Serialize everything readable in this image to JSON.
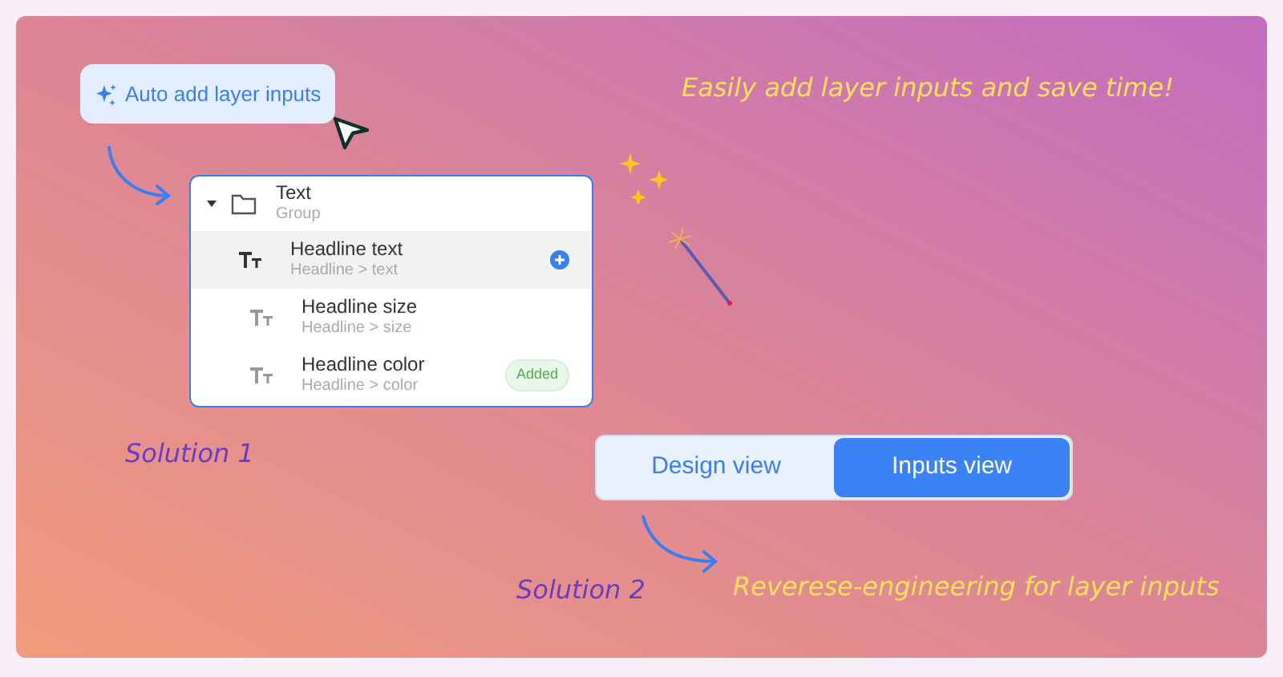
{
  "auto_button": {
    "label": "Auto add layer inputs"
  },
  "headline": "Easily add layer inputs and save time!",
  "layer_panel": {
    "group": {
      "title": "Text",
      "subtitle": "Group",
      "expanded": true
    },
    "items": [
      {
        "title": "Headline text",
        "path": "Headline > text",
        "selected": true
      },
      {
        "title": "Headline size",
        "path": "Headline > size",
        "selected": false
      },
      {
        "title": "Headline color",
        "path": "Headline > color",
        "selected": false,
        "badge": "Added"
      }
    ]
  },
  "solution_1": "Solution 1",
  "view_tabs": [
    {
      "label": "Design view",
      "selected": false
    },
    {
      "label": "Inputs view",
      "selected": true
    }
  ],
  "solution_2": "Solution 2",
  "caption": "Reverese-engineering for layer inputs"
}
